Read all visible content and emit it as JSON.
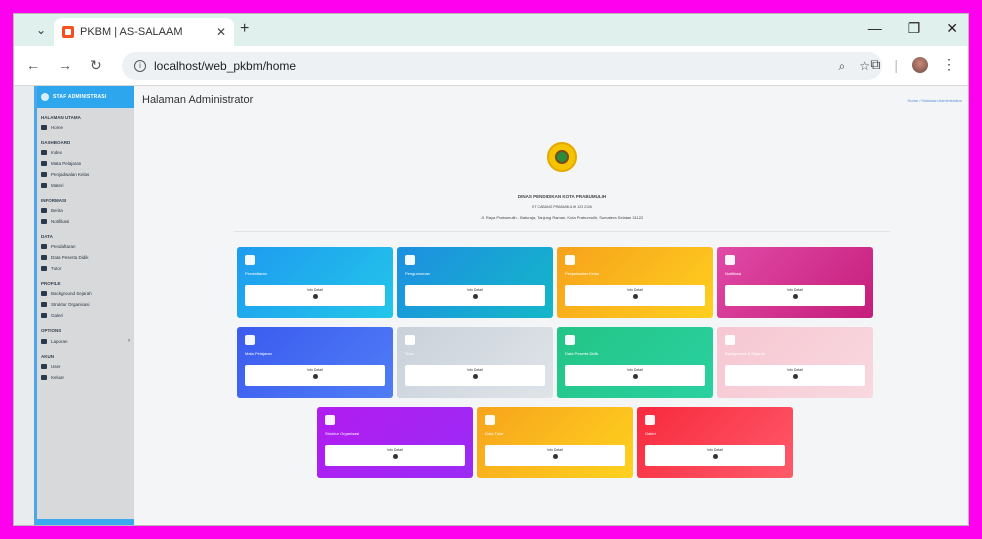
{
  "browser": {
    "tab_title": "PKBM | AS-SALAAM",
    "url": "localhost/web_pkbm/home"
  },
  "sidebar": {
    "header": "STAF ADMINISTRASI",
    "groups": [
      {
        "section": "HALAMAN UTAMA",
        "items": [
          {
            "label": "Home"
          }
        ]
      },
      {
        "section": "DASHBOARD",
        "items": [
          {
            "label": "Index"
          },
          {
            "label": "Mata Pelajaran"
          },
          {
            "label": "Penjadwalan Kelas"
          },
          {
            "label": "Materi"
          }
        ]
      },
      {
        "section": "INFORMASI",
        "items": [
          {
            "label": "Berita"
          },
          {
            "label": "Notifikasi"
          }
        ]
      },
      {
        "section": "DATA",
        "items": [
          {
            "label": "Pendaftaran"
          },
          {
            "label": "Data Peserta Didik"
          },
          {
            "label": "Tutor"
          }
        ]
      },
      {
        "section": "PROFILE",
        "items": [
          {
            "label": "Background Sejarah"
          },
          {
            "label": "Struktur Organisasi"
          },
          {
            "label": "Galeri"
          }
        ]
      },
      {
        "section": "OPTIONS",
        "items": [
          {
            "label": "Laporan",
            "chevron": "›"
          }
        ]
      },
      {
        "section": "AKUN",
        "items": [
          {
            "label": "User"
          },
          {
            "label": "Keluar"
          }
        ]
      }
    ]
  },
  "main": {
    "title": "Halaman Administrator",
    "breadcrumb": "Home / Halaman Administrator",
    "org_name": "DINAS PENDIDIKAN KOTA PRABUMULIH",
    "org_sub": "KT CABANG PRABUMULIH 123 2106",
    "address": "Jl. Raya Prabumulih - Baturaja, Tanjung Raman, Kota Prabumulih, Sumatera Selatan 31122",
    "more_info": "Info Detail",
    "cards": [
      {
        "label": "Pendaftaran",
        "gradient": [
          "#1e9bf0",
          "#23c6e9"
        ]
      },
      {
        "label": "Pengumuman",
        "gradient": [
          "#1d8fe2",
          "#14b7c8"
        ]
      },
      {
        "label": "Penjadwalan Kelas",
        "gradient": [
          "#f6a21b",
          "#ffcf1f"
        ]
      },
      {
        "label": "Notifikasi",
        "gradient": [
          "#e14aa7",
          "#c51d7b"
        ]
      },
      {
        "label": "Mata Pelajaran",
        "gradient": [
          "#3b5bf0",
          "#4f7df5"
        ]
      },
      {
        "label": "Tutor",
        "gradient": [
          "#c9d1da",
          "#dfe4e9"
        ]
      },
      {
        "label": "Data Peserta Didik",
        "gradient": [
          "#23c486",
          "#2ad1a0"
        ]
      },
      {
        "label": "Background & Sejarah",
        "gradient": [
          "#f6c7d2",
          "#f9d8df"
        ]
      },
      {
        "label": "Struktur Organisasi",
        "gradient": [
          "#b21cf0",
          "#9b2bf5"
        ]
      },
      {
        "label": "Data Tutor",
        "gradient": [
          "#f7a41c",
          "#ffd21f"
        ]
      },
      {
        "label": "Galeri",
        "gradient": [
          "#f8293d",
          "#ff5a6b"
        ]
      }
    ]
  }
}
